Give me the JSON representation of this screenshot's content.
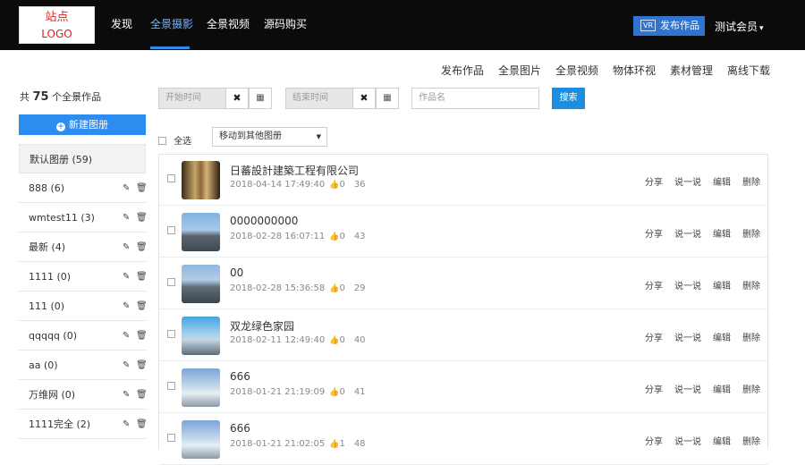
{
  "logo": {
    "line1": "站点",
    "line2": "LOGO"
  },
  "nav": [
    "发现",
    "全景摄影",
    "全景视频",
    "源码购买"
  ],
  "header": {
    "vr_label": "VR",
    "publish_label": "发布作品",
    "member_label": "测试会员",
    "caret": "▾"
  },
  "subnav": [
    "发布作品",
    "全景图片",
    "全景视频",
    "物体环视",
    "素材管理",
    "离线下载"
  ],
  "sidebar": {
    "count_prefix": "共",
    "count_value": "75",
    "count_suffix": "个全景作品",
    "new_album_label": "新建图册",
    "albums": [
      {
        "label": "默认图册 (59)"
      },
      {
        "label": "888 (6)"
      },
      {
        "label": "wmtest11 (3)"
      },
      {
        "label": "最新 (4)"
      },
      {
        "label": "1111 (0)"
      },
      {
        "label": "111 (0)"
      },
      {
        "label": "qqqqq (0)"
      },
      {
        "label": "aa (0)"
      },
      {
        "label": "万维网 (0)"
      },
      {
        "label": "1111完全 (2)"
      }
    ]
  },
  "filters": {
    "start_placeholder": "开始时间",
    "end_placeholder": "结束时间",
    "name_placeholder": "作品名",
    "search_label": "搜索",
    "clear_glyph": "✖",
    "calendar_glyph": "▦"
  },
  "toolbar": {
    "select_all_label": "全选",
    "move_label": "移动到其他图册",
    "move_arrow": "▼"
  },
  "works": [
    {
      "title": "日蕃設計建築工程有限公司",
      "date": "2018-04-14 17:49:40",
      "likes": "0",
      "views": "36"
    },
    {
      "title": "0000000000",
      "date": "2018-02-28 16:07:11",
      "likes": "0",
      "views": "43"
    },
    {
      "title": "00",
      "date": "2018-02-28 15:36:58",
      "likes": "0",
      "views": "29"
    },
    {
      "title": "双龙绿色家园",
      "date": "2018-02-11 12:49:40",
      "likes": "0",
      "views": "40"
    },
    {
      "title": "666",
      "date": "2018-01-21 21:19:09",
      "likes": "0",
      "views": "41"
    },
    {
      "title": "666",
      "date": "2018-01-21 21:02:05",
      "likes": "1",
      "views": "48"
    }
  ],
  "row_actions": {
    "share": "分享",
    "comment": "说一说",
    "edit": "编辑",
    "delete": "删除"
  },
  "like_glyph": "👍",
  "colors": {
    "accent": "#2d8cf0",
    "topbar": "#0b0b0b",
    "search": "#1a8fe0"
  }
}
